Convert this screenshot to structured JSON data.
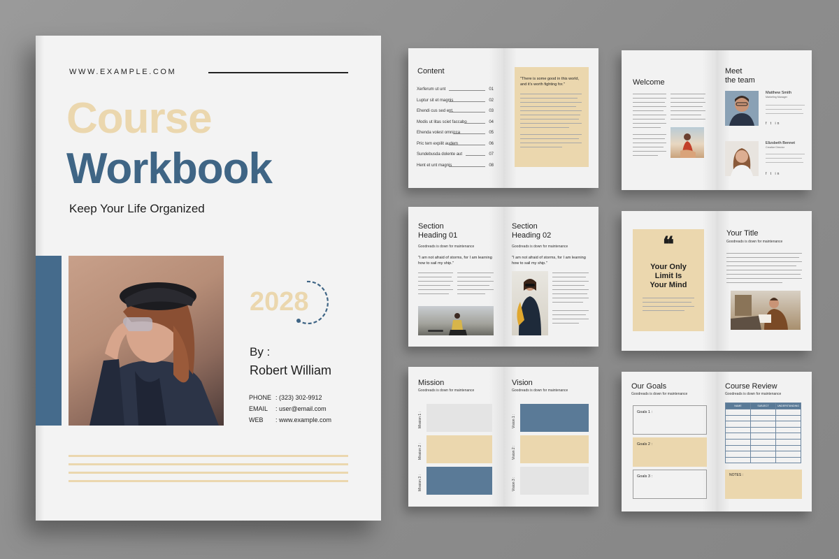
{
  "cover": {
    "website": "WWW.EXAMPLE.COM",
    "title_line1": "Course",
    "title_line2": "Workbook",
    "tagline": "Keep Your Life Organized",
    "year": "2028",
    "by_label": "By :",
    "author": "Robert William",
    "contact": [
      {
        "label": "PHONE",
        "value": ": (323) 302-9912"
      },
      {
        "label": "EMAIL",
        "value": ": user@email.com"
      },
      {
        "label": "WEB",
        "value": ": www.example.com"
      }
    ],
    "colors": {
      "beige": "#ebd7ae",
      "blue": "#3f6585"
    }
  },
  "content_spread": {
    "title": "Content",
    "items": [
      {
        "label": "Xerferum ut unt",
        "num": "01"
      },
      {
        "label": "Luptur sit et magnis",
        "num": "02"
      },
      {
        "label": "Ehendi cus sed ent.",
        "num": "03"
      },
      {
        "label": "Modis ut litas sciet faccabo",
        "num": "04"
      },
      {
        "label": "Ehenda volest omnicca",
        "num": "05"
      },
      {
        "label": "Pric tem expilit audem",
        "num": "06"
      },
      {
        "label": "Sundebusda dolente aut",
        "num": "07"
      },
      {
        "label": "Hent et unt magnis",
        "num": "08"
      }
    ],
    "quote": "\"There is some good in this world, and it's worth fighting for.\""
  },
  "welcome_spread": {
    "title": "Welcome",
    "team_title_line1": "Meet",
    "team_title_line2": "the team",
    "members": [
      {
        "name": "Matthew Smith",
        "role": "Marketing Manager"
      },
      {
        "name": "Elizsbeth Bennet",
        "role": "Creative Director"
      }
    ],
    "social_icons": "f t in"
  },
  "section_spread": {
    "left_heading_line1": "Section",
    "left_heading_line2": "Heading 01",
    "right_heading_line1": "Section",
    "right_heading_line2": "Heading 02",
    "subtitle": "Goodreads is down for maintenance",
    "quote": "\"I am not afraid of storms, for I am learning how to sail my ship.\""
  },
  "quote_spread": {
    "quote_mark": "❝",
    "quote_line1": "Your Only",
    "quote_line2": "Limit Is",
    "quote_line3": "Your Mind",
    "title": "Your Title",
    "subtitle": "Goodreads is down for maintenance"
  },
  "mission_spread": {
    "left_title": "Mission",
    "right_title": "Vision",
    "subtitle": "Goodreads is down for maintenance",
    "mission_labels": [
      "Mission 1 :",
      "Mission 2 :",
      "Mission 3 :"
    ],
    "vision_labels": [
      "Vision 1 :",
      "Vision 2 :",
      "Vision 3 :"
    ]
  },
  "goals_spread": {
    "left_title": "Our Goals",
    "right_title": "Course Review",
    "subtitle": "Goodreads is down for maintenance",
    "goals": [
      "Goals 1 :",
      "Goals 2 :",
      "Goals 3 :"
    ],
    "table_headers": [
      "NAME",
      "SUBJECT",
      "UNDERSTANDING"
    ],
    "notes_label": "NOTES :"
  }
}
